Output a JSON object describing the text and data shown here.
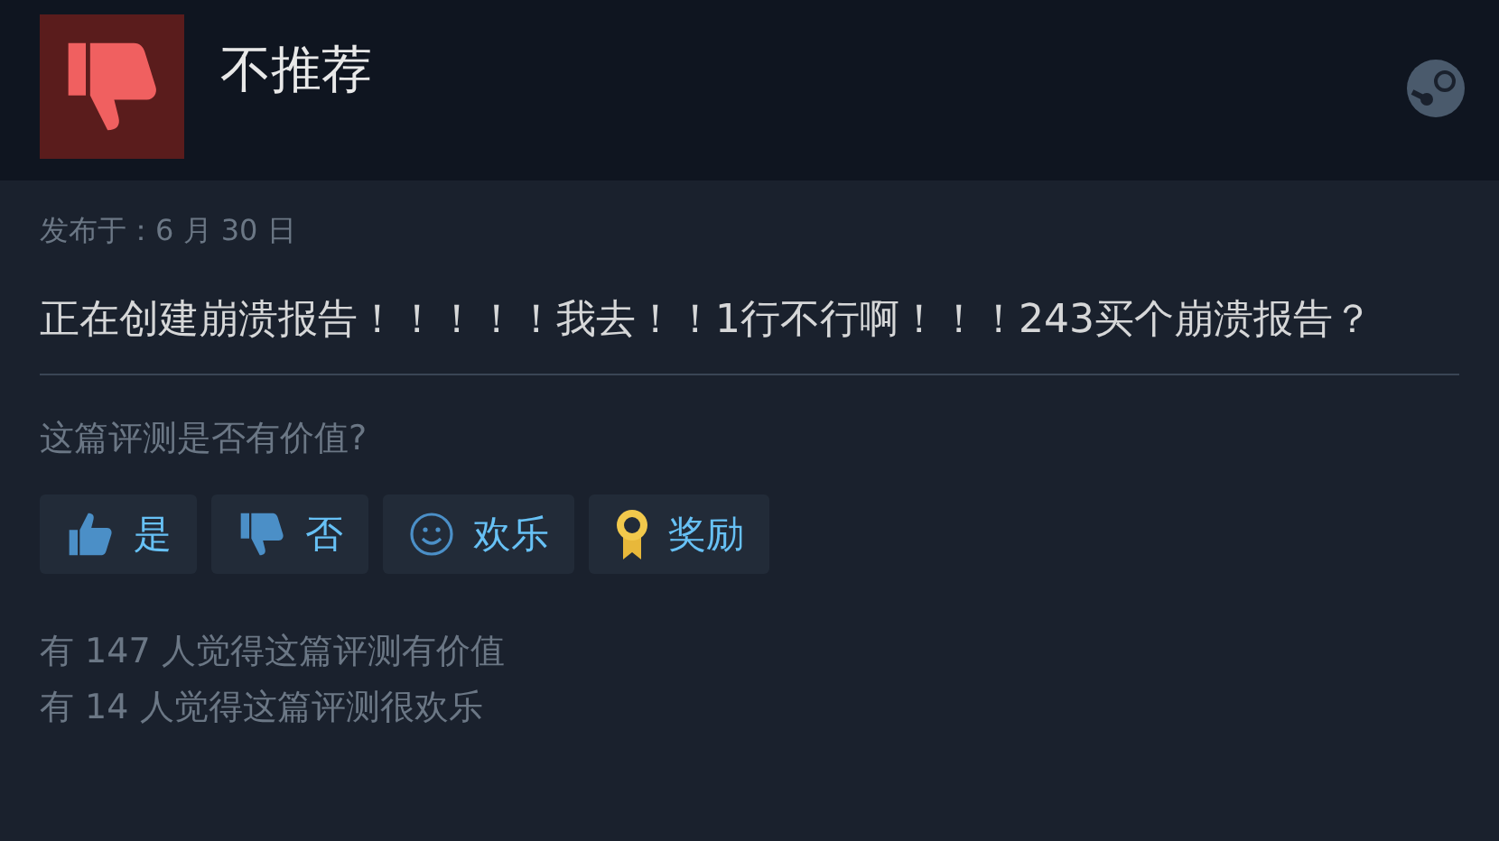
{
  "review": {
    "recommended": false,
    "verdict": "不推荐",
    "posted": "发布于：6 月 30 日",
    "text": "正在创建崩溃报告！！！！！我去！！1行不行啊！！！243买个崩溃报告？"
  },
  "feedback": {
    "question": "这篇评测是否有价值?",
    "buttons": [
      {
        "kind": "yes",
        "label": "是"
      },
      {
        "kind": "no",
        "label": "否"
      },
      {
        "kind": "funny",
        "label": "欢乐"
      },
      {
        "kind": "award",
        "label": "奖励"
      }
    ],
    "stats": [
      "有 147 人觉得这篇评测有价值",
      "有 14 人觉得这篇评测很欢乐"
    ]
  }
}
